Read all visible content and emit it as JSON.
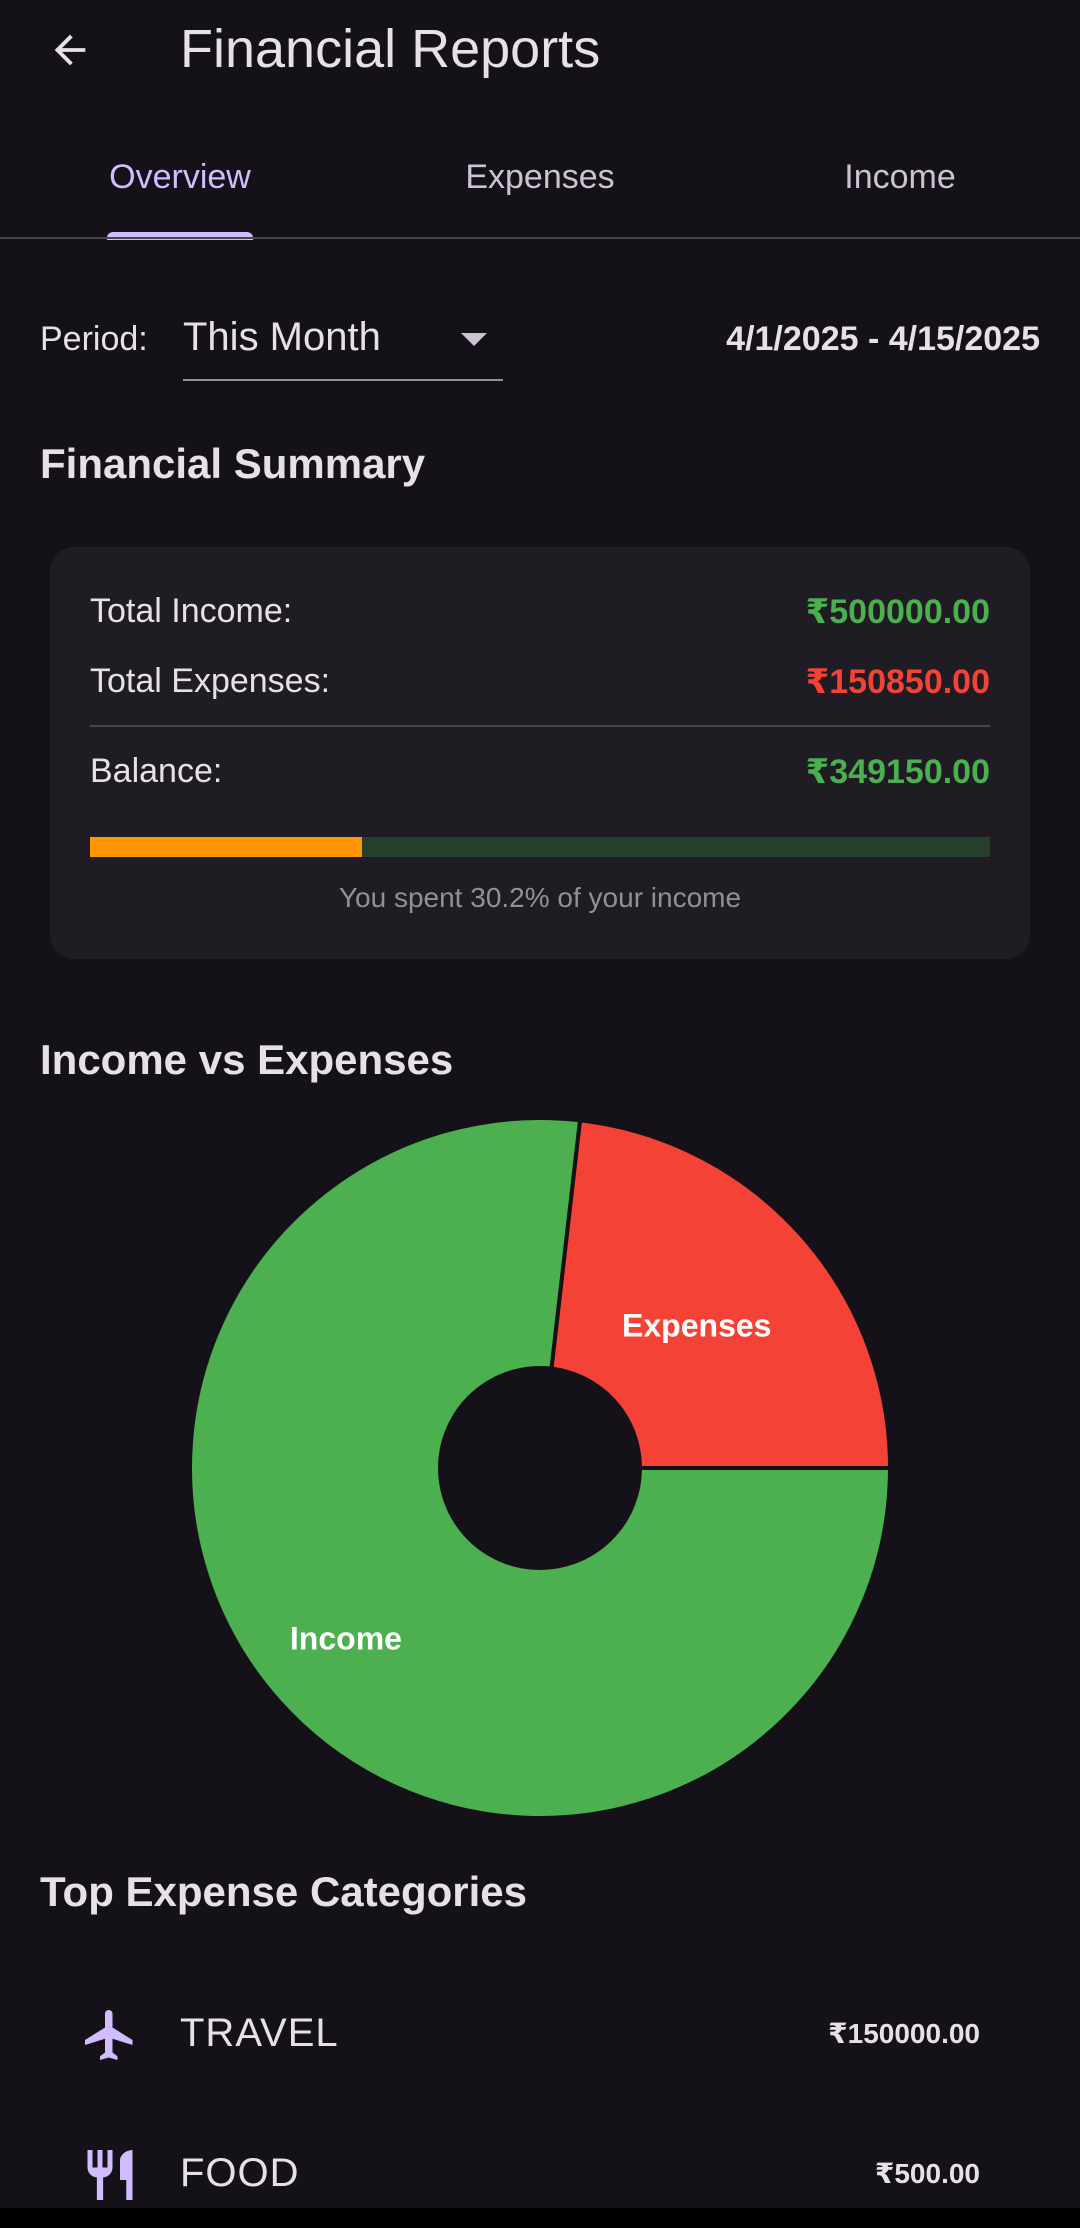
{
  "appbar": {
    "title": "Financial Reports",
    "back_icon": "arrow-left-icon"
  },
  "tabs": [
    {
      "label": "Overview",
      "active": true
    },
    {
      "label": "Expenses",
      "active": false
    },
    {
      "label": "Income",
      "active": false
    }
  ],
  "period": {
    "label": "Period:",
    "value": "This Month",
    "date_range": "4/1/2025 - 4/15/2025"
  },
  "summary": {
    "title": "Financial Summary",
    "income_label": "Total Income:",
    "income_value": "₹500000.00",
    "expenses_label": "Total Expenses:",
    "expenses_value": "₹150850.00",
    "balance_label": "Balance:",
    "balance_value": "₹349150.00",
    "spent_fraction": 0.302,
    "caption": "You spent 30.2% of your income",
    "colors": {
      "income": "#4caf50",
      "expenses": "#f44336",
      "balance": "#4caf50",
      "progress_fill": "#ff9800",
      "progress_track": "#27402b"
    }
  },
  "chart_section": {
    "title": "Income vs Expenses"
  },
  "chart_data": {
    "type": "pie",
    "donut": true,
    "categories": [
      "Income",
      "Expenses"
    ],
    "values": [
      500000,
      150850
    ],
    "colors": [
      "#4caf50",
      "#f44336"
    ]
  },
  "categories_section": {
    "title": "Top Expense Categories",
    "items": [
      {
        "name": "TRAVEL",
        "amount": "₹150000.00",
        "icon": "airplane-icon"
      },
      {
        "name": "FOOD",
        "amount": "₹500.00",
        "icon": "restaurant-icon"
      }
    ]
  }
}
